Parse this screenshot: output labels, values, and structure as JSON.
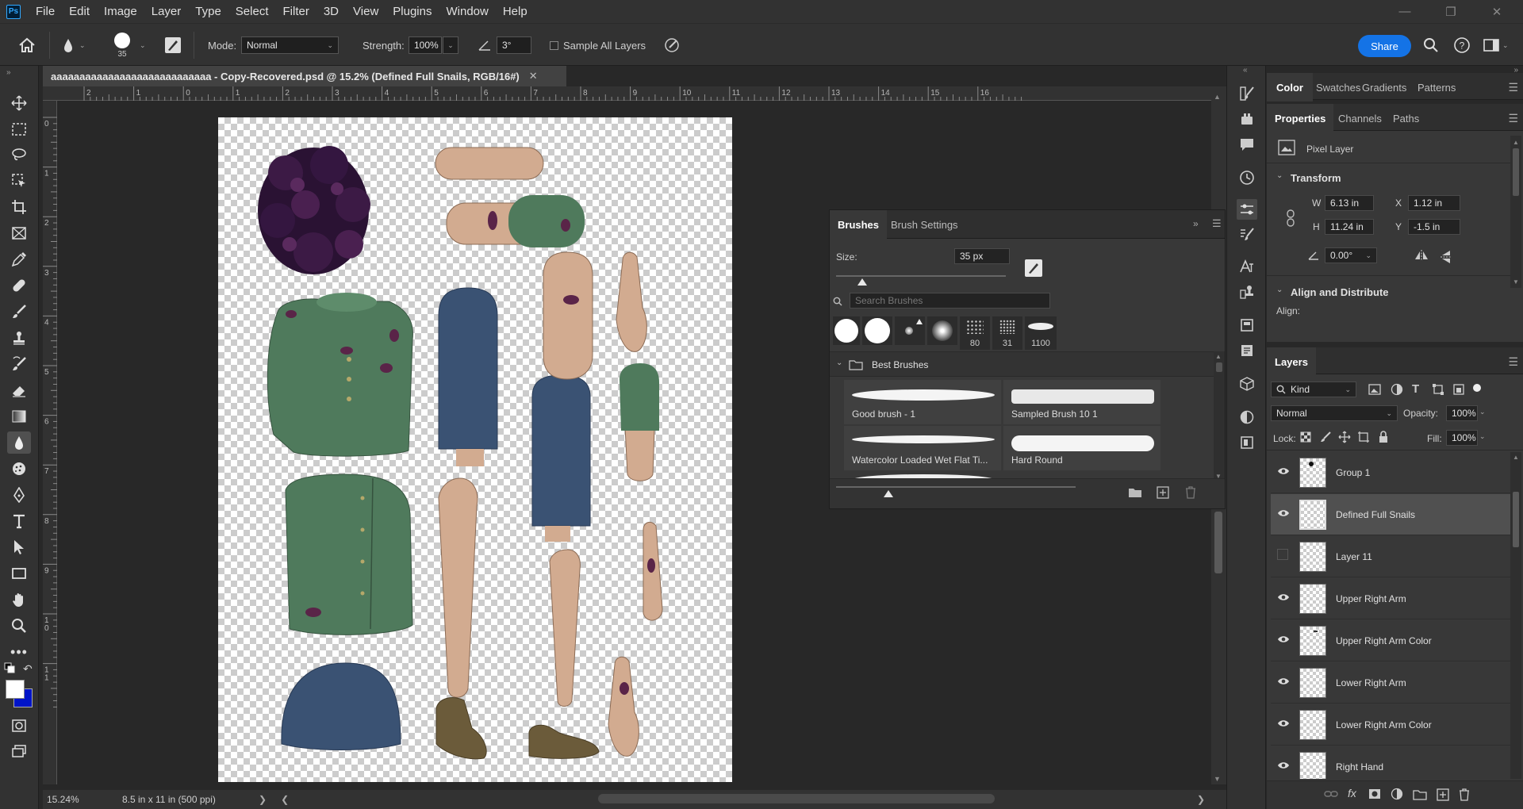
{
  "menubar": {
    "logo": "Ps",
    "items": [
      "File",
      "Edit",
      "Image",
      "Layer",
      "Type",
      "Select",
      "Filter",
      "3D",
      "View",
      "Plugins",
      "Window",
      "Help"
    ]
  },
  "options": {
    "brush_size": "35",
    "mode_label": "Mode:",
    "mode_value": "Normal",
    "strength_label": "Strength:",
    "strength_value": "100%",
    "angle_value": "3°",
    "sample_all_layers": "Sample All Layers",
    "share": "Share"
  },
  "document": {
    "tab_title": "aaaaaaaaaaaaaaaaaaaaaaaaaaaa - Copy-Recovered.psd @ 15.2% (Defined Full Snails, RGB/16#)",
    "zoom": "15.24%",
    "doc_info": "8.5 in x 11 in (500 ppi)"
  },
  "rulers": {
    "h_ticks": [
      "2",
      "1",
      "0",
      "1",
      "2",
      "3",
      "4",
      "5",
      "6",
      "7",
      "8",
      "9",
      "10",
      "11",
      "12",
      "13",
      "14",
      "15",
      "16"
    ],
    "v_ticks": [
      "0",
      "1",
      "2",
      "3",
      "4",
      "5",
      "6",
      "7",
      "8",
      "9",
      "1\n0",
      "1\n1"
    ]
  },
  "brushes_panel": {
    "tabs": [
      "Brushes",
      "Brush Settings"
    ],
    "size_label": "Size:",
    "size_value": "35 px",
    "size_fraction": 0.04,
    "search_placeholder": "Search Brushes",
    "tip_numbers": [
      "80",
      "31",
      "1100"
    ],
    "folder": "Best Brushes",
    "brushes": [
      "Good brush - 1",
      "Sampled Brush 10 1",
      "Watercolor Loaded Wet Flat Ti...",
      "Hard Round"
    ]
  },
  "color_panel": {
    "tabs": [
      "Color",
      "Swatches",
      "Gradients",
      "Patterns"
    ]
  },
  "properties_panel": {
    "tabs": [
      "Properties",
      "Channels",
      "Paths"
    ],
    "layer_type": "Pixel Layer",
    "transform_title": "Transform",
    "w_label": "W",
    "w_value": "6.13 in",
    "x_label": "X",
    "x_value": "1.12 in",
    "h_label": "H",
    "h_value": "11.24 in",
    "y_label": "Y",
    "y_value": "-1.5 in",
    "angle_value": "0.00°",
    "align_title": "Align and Distribute",
    "align_label": "Align:"
  },
  "layers_panel": {
    "title": "Layers",
    "kind_filter": "Kind",
    "blend_mode": "Normal",
    "opacity_label": "Opacity:",
    "opacity_value": "100%",
    "lock_label": "Lock:",
    "fill_label": "Fill:",
    "fill_value": "100%",
    "layers": [
      {
        "name": "Group 1",
        "visible": true,
        "selected": false
      },
      {
        "name": "Defined Full Snails",
        "visible": true,
        "selected": true
      },
      {
        "name": "Layer 11",
        "visible": false,
        "selected": false
      },
      {
        "name": "Upper Right Arm",
        "visible": true,
        "selected": false
      },
      {
        "name": "Upper Right Arm Color",
        "visible": true,
        "selected": false
      },
      {
        "name": "Lower Right Arm",
        "visible": true,
        "selected": false
      },
      {
        "name": "Lower Right Arm Color",
        "visible": true,
        "selected": false
      },
      {
        "name": "Right Hand",
        "visible": true,
        "selected": false
      }
    ]
  },
  "colors": {
    "accent": "#1473e6",
    "sweater": "#4f7a5c",
    "denim": "#3a5273",
    "skin": "#d2ab90",
    "boot": "#6b5b3a",
    "hair": "#2a1233",
    "snail": "#5a2448"
  }
}
